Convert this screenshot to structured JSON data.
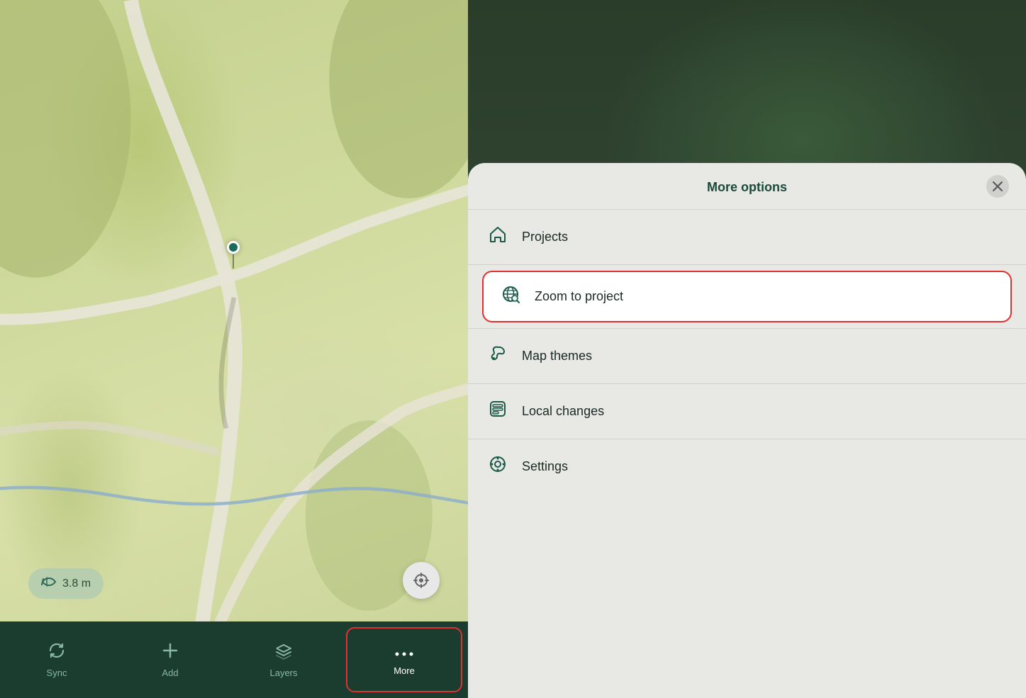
{
  "map": {
    "distance_badge": "3.8 m",
    "gps_marker_visible": true
  },
  "bottom_nav": {
    "items": [
      {
        "id": "sync",
        "label": "Sync",
        "icon": "sync"
      },
      {
        "id": "add",
        "label": "Add",
        "icon": "plus"
      },
      {
        "id": "layers",
        "label": "Layers",
        "icon": "layers"
      },
      {
        "id": "more",
        "label": "More",
        "icon": "more",
        "active": true
      }
    ]
  },
  "modal": {
    "title": "More options",
    "close_label": "×",
    "menu_items": [
      {
        "id": "projects",
        "label": "Projects",
        "icon": "home",
        "highlighted": false
      },
      {
        "id": "zoom_to_project",
        "label": "Zoom to project",
        "icon": "globe-zoom",
        "highlighted": true
      },
      {
        "id": "map_themes",
        "label": "Map themes",
        "icon": "brush",
        "highlighted": false
      },
      {
        "id": "local_changes",
        "label": "Local changes",
        "icon": "local-changes",
        "highlighted": false
      },
      {
        "id": "settings",
        "label": "Settings",
        "icon": "settings",
        "highlighted": false
      }
    ]
  }
}
